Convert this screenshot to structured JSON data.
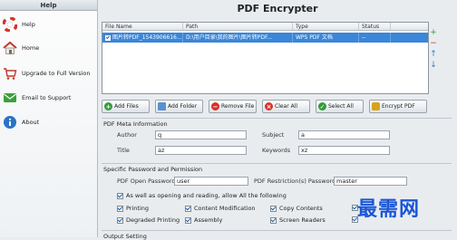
{
  "sidebar": {
    "title": "Help",
    "items": [
      {
        "label": "Help"
      },
      {
        "label": "Home"
      },
      {
        "label": "Upgrade to Full Version"
      },
      {
        "label": "Email to Support"
      },
      {
        "label": "About"
      }
    ]
  },
  "app_title": "PDF Encrypter",
  "file_table": {
    "columns": [
      "File Name",
      "Path",
      "Type",
      "Status"
    ],
    "rows": [
      {
        "name": "图片转PDF_1543906616...",
        "path": "D:\\用户目录\\我的图片\\图片转PDF...",
        "type": "WPS PDF 文档",
        "status": "--",
        "checked": true
      }
    ]
  },
  "toolbar": {
    "add_files": "Add Files",
    "add_folder": "Add Folder",
    "remove_file": "Remove File",
    "clear_all": "Clear All",
    "select_all": "Select All",
    "encrypt_pdf": "Encrypt PDF"
  },
  "meta": {
    "section_title": "PDF Meta Information",
    "author_label": "Author",
    "author_value": "q",
    "subject_label": "Subject",
    "subject_value": "a",
    "title_label": "Title",
    "title_value": "az",
    "keywords_label": "Keywords",
    "keywords_value": "xz"
  },
  "security": {
    "section_title": "Specific Password and Permission",
    "open_pw_label": "PDF Open Password",
    "open_pw_value": "user",
    "restrict_pw_label": "PDF Restriction(s) Password",
    "restrict_pw_value": "master",
    "allow_all_label": "As well as opening and reading, allow All the following",
    "permissions": [
      "Printing",
      "Content Modification",
      "Copy Contents",
      "Degraded Printing",
      "Assembly",
      "Screen Readers"
    ]
  },
  "output": {
    "section_title": "Output Setting"
  },
  "watermark_text": "最需网",
  "colors": {
    "selection": "#3a86d8",
    "watermark": "#1a56d6"
  }
}
